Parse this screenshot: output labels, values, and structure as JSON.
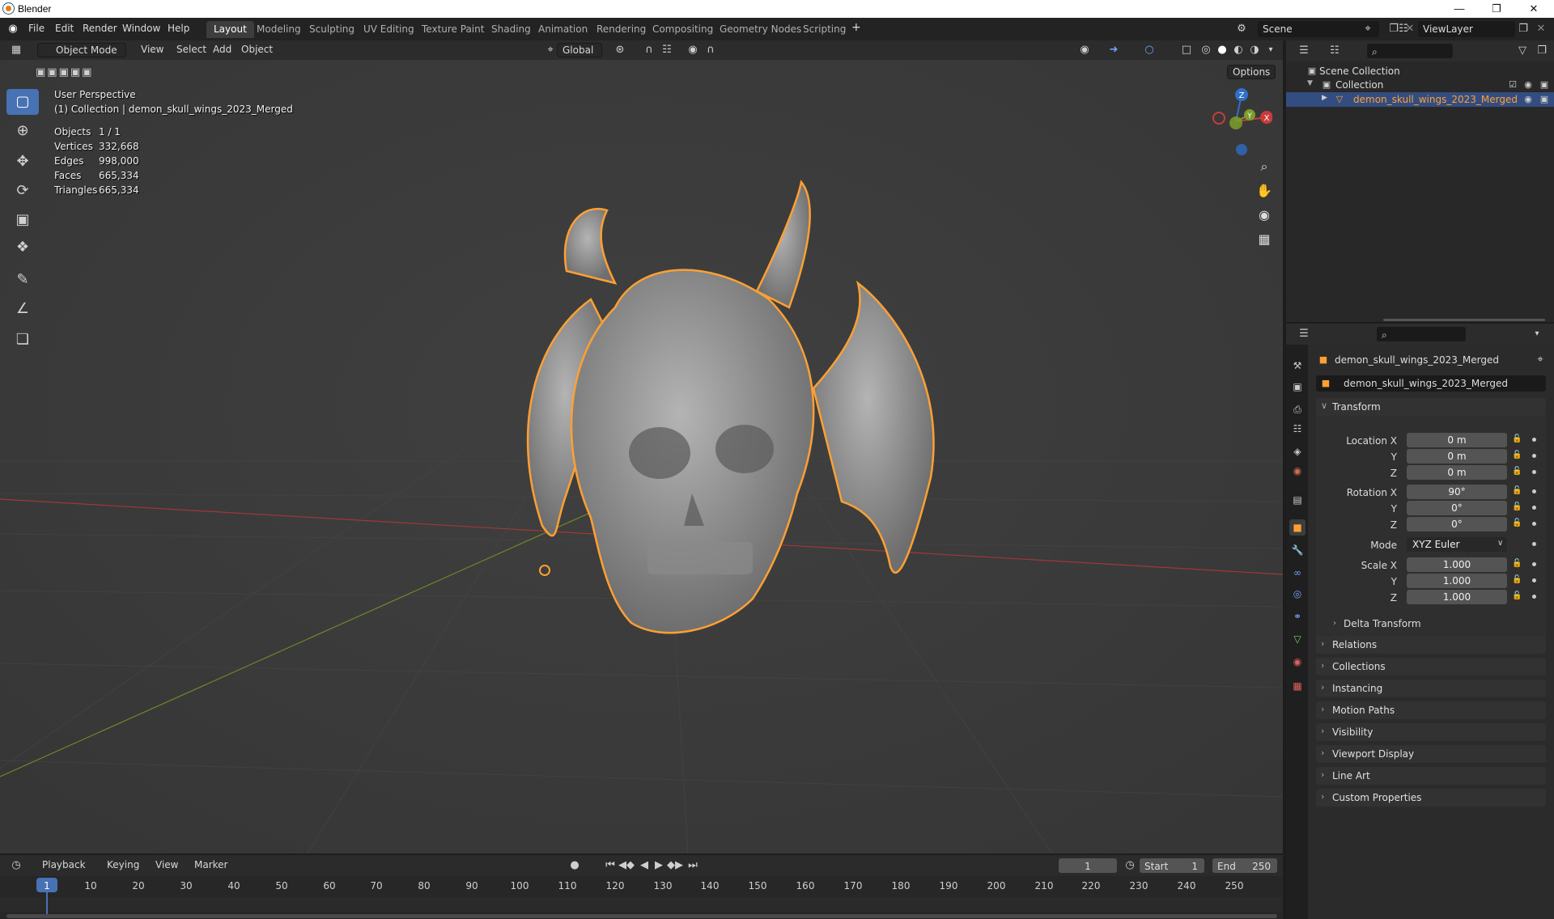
{
  "window": {
    "title": "Blender"
  },
  "menu": [
    "File",
    "Edit",
    "Render",
    "Window",
    "Help"
  ],
  "workspaces": [
    "Layout",
    "Modeling",
    "Sculpting",
    "UV Editing",
    "Texture Paint",
    "Shading",
    "Animation",
    "Rendering",
    "Compositing",
    "Geometry Nodes",
    "Scripting"
  ],
  "add_workspace": "+",
  "scene": {
    "name": "Scene",
    "view_layer": "ViewLayer"
  },
  "viewport": {
    "mode": "Object Mode",
    "menus": [
      "View",
      "Select",
      "Add",
      "Object"
    ],
    "orientation": "Global",
    "options_label": "Options",
    "perspective": "User Perspective",
    "collection_info": "(1) Collection | demon_skull_wings_2023_Merged",
    "stats": [
      {
        "label": "Objects",
        "value": "1 / 1"
      },
      {
        "label": "Vertices",
        "value": "332,668"
      },
      {
        "label": "Edges",
        "value": "998,000"
      },
      {
        "label": "Faces",
        "value": "665,334"
      },
      {
        "label": "Triangles",
        "value": "665,334"
      }
    ],
    "gizmo": {
      "z": "Z",
      "y": "Y",
      "x": "X"
    }
  },
  "outliner": {
    "scene_collection": "Scene Collection",
    "collection": "Collection",
    "object": "demon_skull_wings_2023_Merged"
  },
  "properties": {
    "object_name": "demon_skull_wings_2023_Merged",
    "object_selector": "demon_skull_wings_2023_Merged",
    "transform_title": "Transform",
    "location_label": "Location X",
    "rotation_label": "Rotation X",
    "scale_label": "Scale X",
    "axis_y": "Y",
    "axis_z": "Z",
    "location": [
      "0 m",
      "0 m",
      "0 m"
    ],
    "rotation": [
      "90°",
      "0°",
      "0°"
    ],
    "mode_label": "Mode",
    "mode_value": "XYZ Euler",
    "scale": [
      "1.000",
      "1.000",
      "1.000"
    ],
    "delta_transform": "Delta Transform",
    "panels": [
      "Relations",
      "Collections",
      "Instancing",
      "Motion Paths",
      "Visibility",
      "Viewport Display",
      "Line Art",
      "Custom Properties"
    ]
  },
  "timeline": {
    "menus": [
      "Playback",
      "Keying",
      "View",
      "Marker"
    ],
    "current_frame": "1",
    "start_label": "Start",
    "start": "1",
    "end_label": "End",
    "end": "250",
    "ticks": [
      "1",
      "10",
      "20",
      "30",
      "40",
      "50",
      "60",
      "70",
      "80",
      "90",
      "100",
      "110",
      "120",
      "130",
      "140",
      "150",
      "160",
      "170",
      "180",
      "190",
      "200",
      "210",
      "220",
      "230",
      "240",
      "250"
    ]
  },
  "colors": {
    "accent": "#4772b3",
    "selection": "#ffa033",
    "x_axis": "#c83c3c",
    "y_axis": "#7c9d2c",
    "z_axis": "#3070c8"
  }
}
